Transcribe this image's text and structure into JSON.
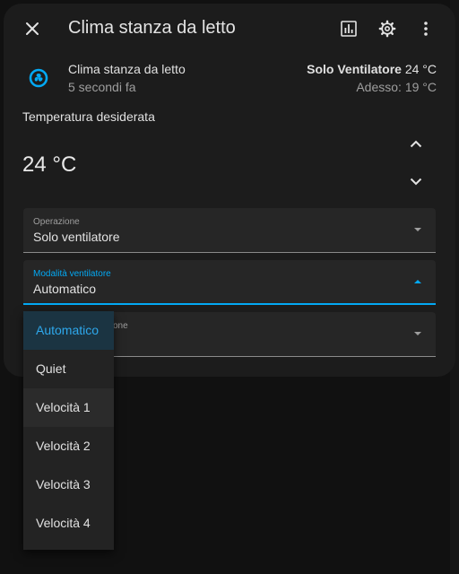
{
  "dialog": {
    "title": "Clima stanza da letto",
    "icons": {
      "close": "close-icon",
      "history": "chart-icon",
      "settings": "gear-icon",
      "more": "dots-vertical-icon"
    }
  },
  "entity": {
    "icon": "fan-icon",
    "icon_color": "#03a9f4",
    "name": "Clima stanza da letto",
    "last_changed": "5 secondi fa",
    "state_mode": "Solo Ventilatore",
    "state_temp": " 24 °C",
    "current": "Adesso: 19 °C"
  },
  "temperature": {
    "label": "Temperatura desiderata",
    "value": "24 °C"
  },
  "fields": {
    "operation": {
      "label": "Operazione",
      "value": "Solo ventilatore"
    },
    "fan_mode": {
      "label": "Modalità ventilatore",
      "value": "Automatico"
    },
    "swing_mode": {
      "label_partial": "one",
      "value": ""
    }
  },
  "fan_menu": {
    "options": [
      "Automatico",
      "Quiet",
      "Velocità 1",
      "Velocità 2",
      "Velocità 3",
      "Velocità 4"
    ],
    "selected": "Automatico"
  },
  "colors": {
    "accent": "#03a9f4",
    "surface": "#1c1c1c",
    "background": "#111111"
  }
}
